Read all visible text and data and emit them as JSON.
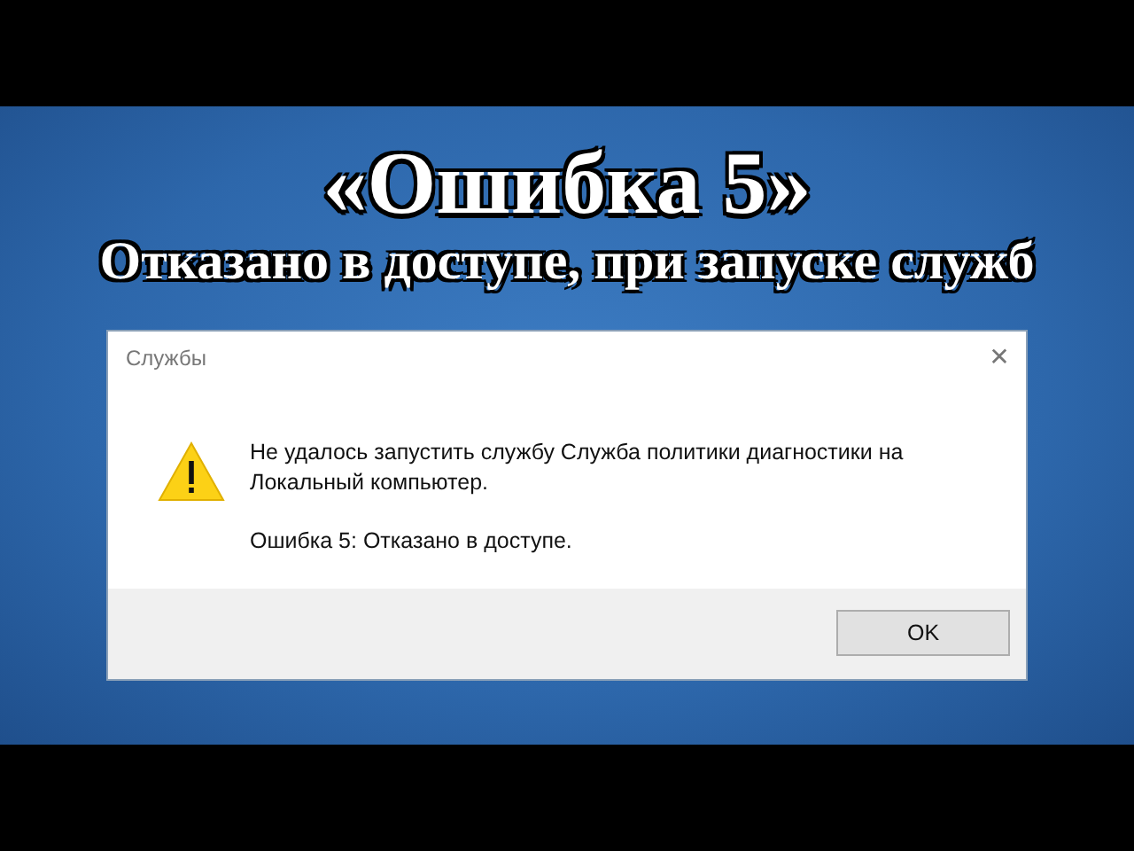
{
  "headline": "«Ошибка 5»",
  "subheadline": "Отказано в доступе, при запуске служб",
  "dialog": {
    "title": "Службы",
    "close": "✕",
    "message": "Не удалось запустить службу Служба политики диагностики на Локальный компьютер.",
    "error": "Ошибка 5: Отказано в доступе.",
    "buttons": [
      "OK"
    ]
  }
}
